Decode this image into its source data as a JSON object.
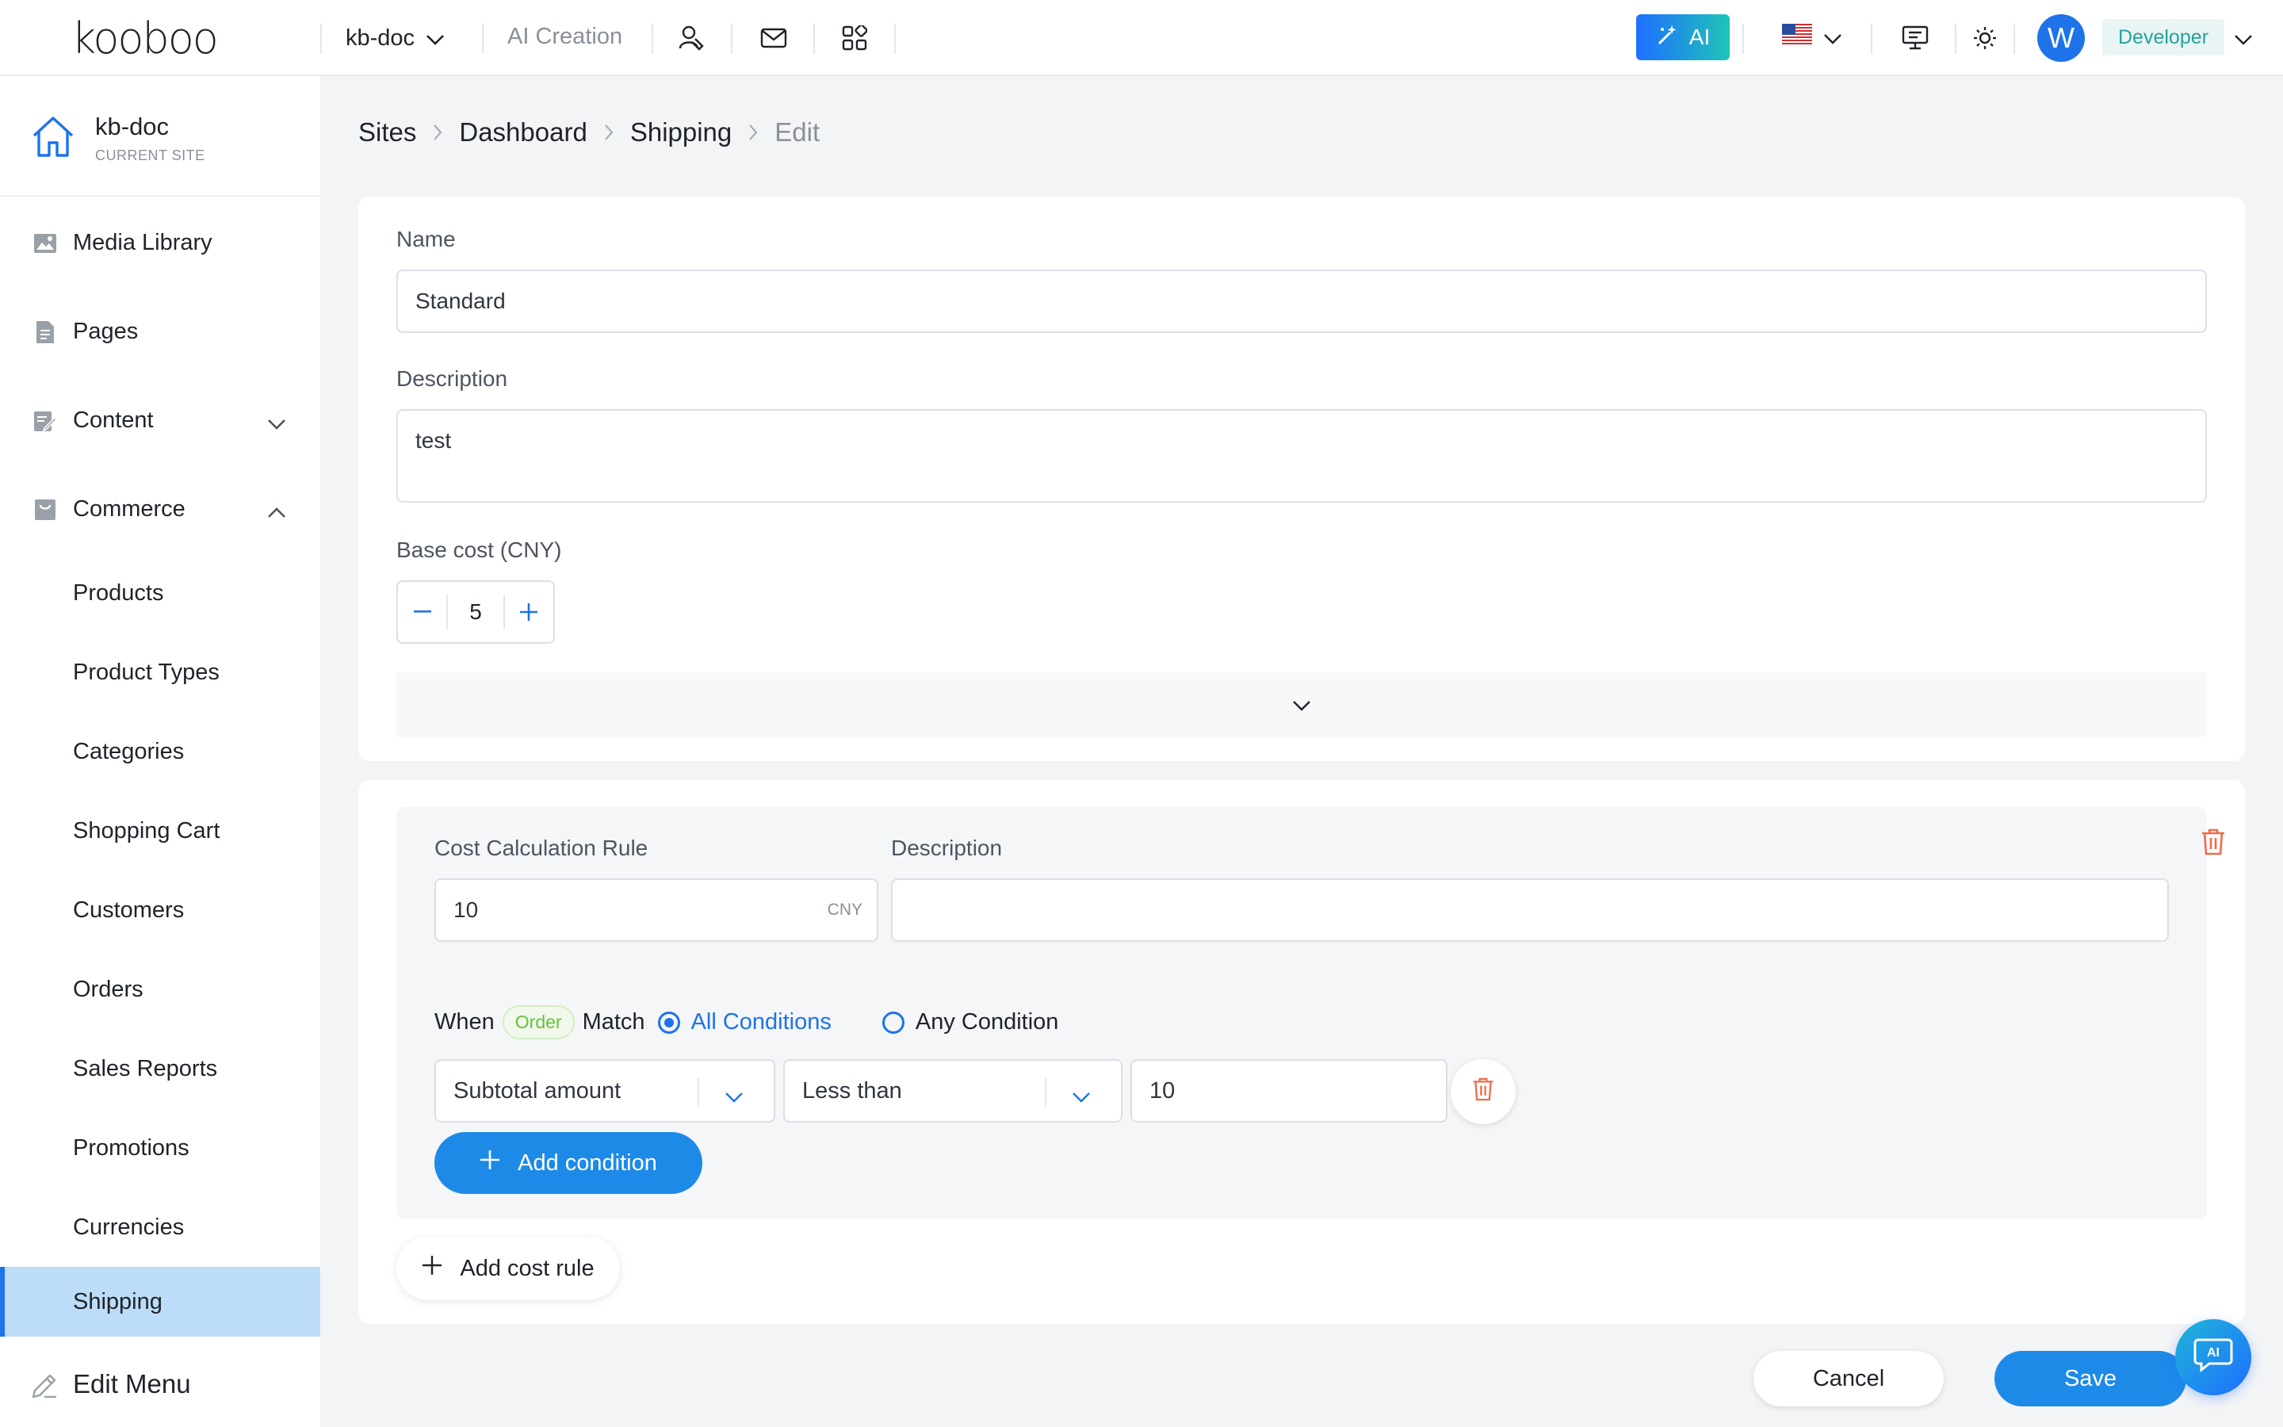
{
  "topbar": {
    "logo": "kooboo",
    "site": "kb-doc",
    "ai_creation": "AI Creation",
    "ai_button": "AI",
    "user_initial": "W",
    "role": "Developer"
  },
  "sidebar": {
    "current_site_name": "kb-doc",
    "current_site_label": "CURRENT SITE",
    "items": [
      {
        "label": "Media Library"
      },
      {
        "label": "Pages"
      },
      {
        "label": "Content"
      },
      {
        "label": "Commerce"
      }
    ],
    "commerce_items": [
      {
        "label": "Products"
      },
      {
        "label": "Product Types"
      },
      {
        "label": "Categories"
      },
      {
        "label": "Shopping Cart"
      },
      {
        "label": "Customers"
      },
      {
        "label": "Orders"
      },
      {
        "label": "Sales Reports"
      },
      {
        "label": "Promotions"
      },
      {
        "label": "Currencies"
      },
      {
        "label": "Shipping"
      }
    ],
    "edit_menu": "Edit Menu"
  },
  "breadcrumb": [
    "Sites",
    "Dashboard",
    "Shipping",
    "Edit"
  ],
  "form": {
    "name_label": "Name",
    "name_value": "Standard",
    "description_label": "Description",
    "description_value": "test",
    "base_cost_label": "Base cost (CNY)",
    "base_cost_value": "5"
  },
  "rule": {
    "cost_label": "Cost Calculation Rule",
    "cost_value": "10",
    "cost_currency": "CNY",
    "description_label": "Description",
    "description_value": "",
    "when": "When",
    "order_tag": "Order",
    "match": "Match",
    "all_conditions": "All Conditions",
    "any_condition": "Any Condition",
    "condition": {
      "field": "Subtotal amount",
      "operator": "Less than",
      "value": "10"
    },
    "add_condition": "Add condition"
  },
  "add_cost_rule": "Add cost rule",
  "footer": {
    "cancel": "Cancel",
    "save": "Save"
  },
  "ai_fab": "AI",
  "colors": {
    "primary": "#1e8ae8",
    "active_nav": "#bcdcf7",
    "danger": "#f06a4a",
    "tag_green": "#67c23a"
  }
}
